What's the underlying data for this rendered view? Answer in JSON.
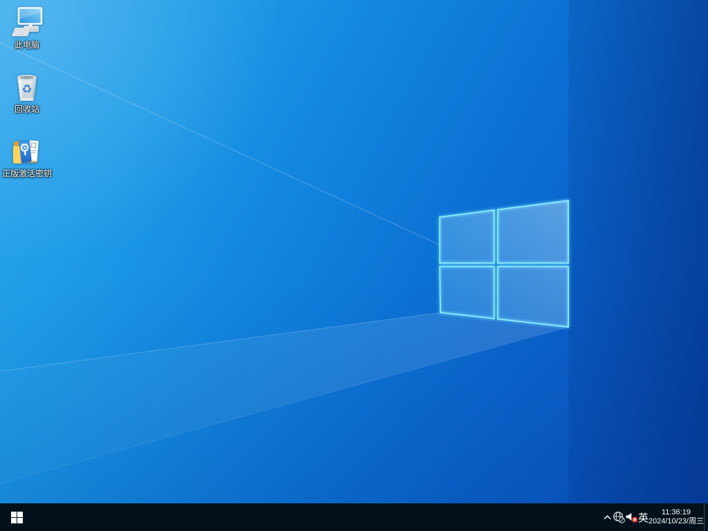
{
  "desktop": {
    "icons": [
      {
        "label": "此电脑",
        "icon": "this-pc-icon"
      },
      {
        "label": "回收站",
        "icon": "recycle-bin-icon"
      },
      {
        "label": "正版激活密钥",
        "icon": "activation-key-folder-icon"
      }
    ]
  },
  "taskbar": {
    "start": {
      "icon": "windows-start-icon"
    },
    "tray": {
      "hidden_icons": {
        "icon": "chevron-up-icon"
      },
      "network": {
        "icon": "globe-no-internet-icon"
      },
      "volume": {
        "icon": "speaker-muted-icon"
      },
      "input_language": "英",
      "clock": {
        "time": "11:36:19",
        "date": "2024/10/23/周三"
      }
    }
  },
  "colors": {
    "taskbar_background": "#03111c",
    "wallpaper_top_left": "#2fa9ec",
    "wallpaper_bottom_right": "#0853bf",
    "logo_edge_glow": "#86ecfb",
    "volume_badge_red": "#d93025"
  }
}
